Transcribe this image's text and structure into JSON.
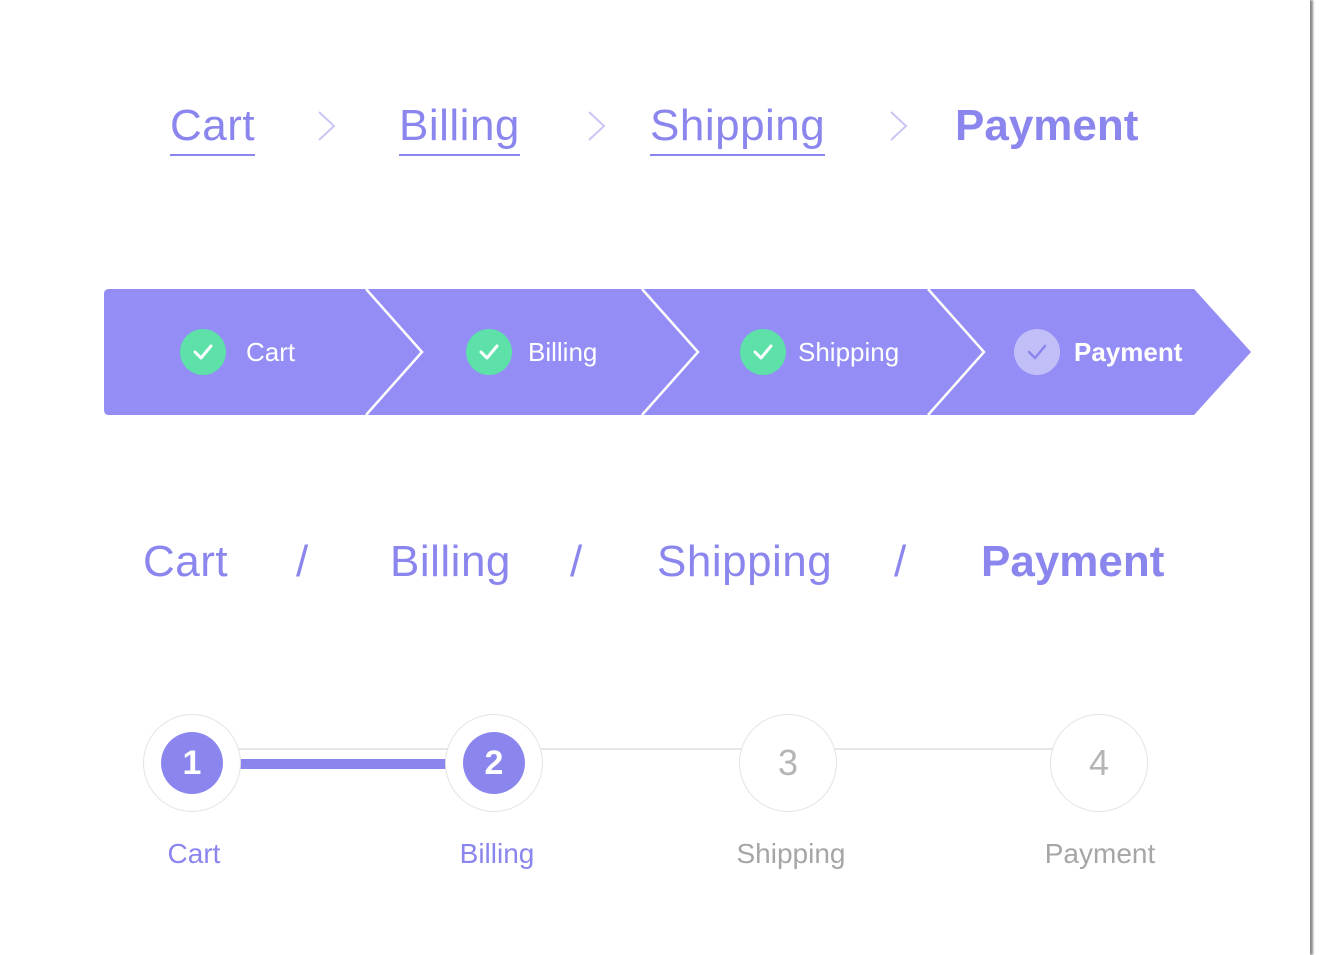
{
  "colors": {
    "accent": "#8b86ee",
    "arrow_bar": "#938df5",
    "check_done": "#5ee0a9",
    "check_current": "#c2bff8",
    "inactive_text": "#a6a6a6",
    "track": "#e6e6e6"
  },
  "breadcrumb_chevron": {
    "separator_icon": "chevron-right-icon",
    "items": [
      {
        "label": "Cart",
        "link": true
      },
      {
        "label": "Billing",
        "link": true
      },
      {
        "label": "Shipping",
        "link": true
      },
      {
        "label": "Payment",
        "current": true
      }
    ]
  },
  "arrow_steps": {
    "items": [
      {
        "label": "Cart",
        "status": "complete",
        "icon": "check-icon"
      },
      {
        "label": "Billing",
        "status": "complete",
        "icon": "check-icon"
      },
      {
        "label": "Shipping",
        "status": "complete",
        "icon": "check-icon"
      },
      {
        "label": "Payment",
        "status": "current",
        "icon": "check-icon"
      }
    ]
  },
  "breadcrumb_slash": {
    "separator": "/",
    "items": [
      {
        "label": "Cart"
      },
      {
        "label": "Billing"
      },
      {
        "label": "Shipping"
      },
      {
        "label": "Payment",
        "current": true
      }
    ]
  },
  "numbered_progress": {
    "completed_through_step": 2,
    "steps": [
      {
        "number": "1",
        "label": "Cart",
        "status": "complete"
      },
      {
        "number": "2",
        "label": "Billing",
        "status": "complete"
      },
      {
        "number": "3",
        "label": "Shipping",
        "status": "upcoming"
      },
      {
        "number": "4",
        "label": "Payment",
        "status": "upcoming"
      }
    ]
  }
}
